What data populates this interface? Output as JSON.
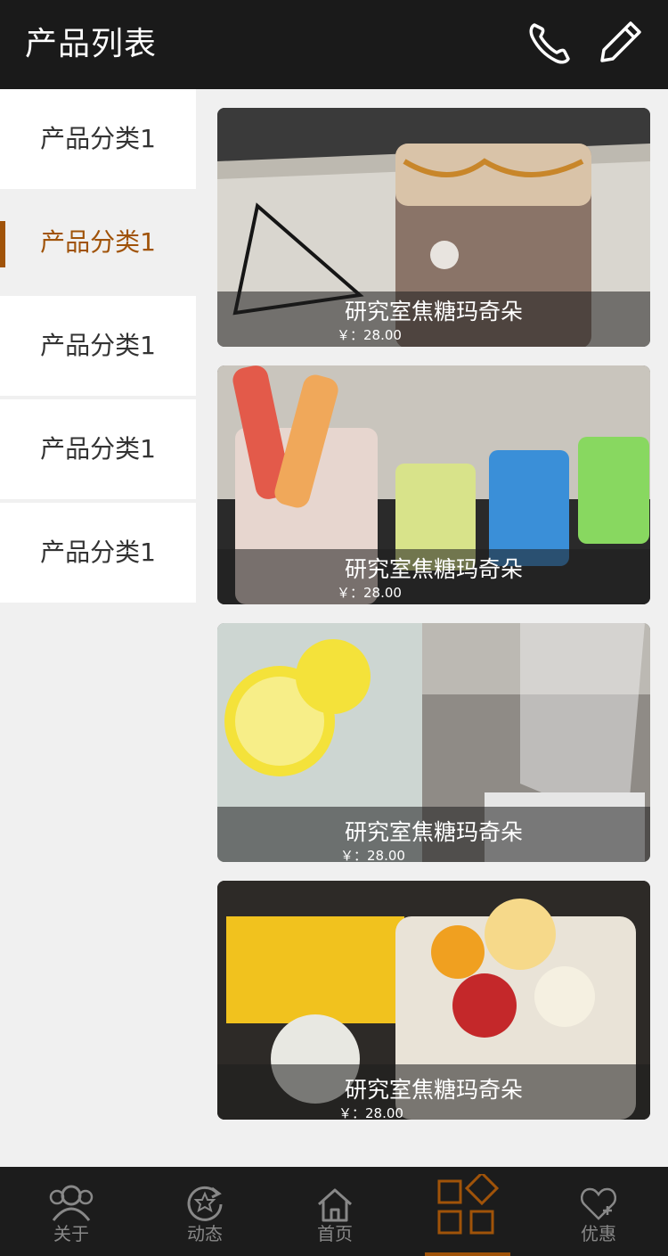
{
  "header": {
    "title": "产品列表",
    "phone_icon": "phone-icon",
    "edit_icon": "pencil-icon"
  },
  "sidebar": {
    "items": [
      {
        "label": "产品分类1",
        "active": false
      },
      {
        "label": "产品分类1",
        "active": true
      },
      {
        "label": "产品分类1",
        "active": false
      },
      {
        "label": "产品分类1",
        "active": false
      },
      {
        "label": "产品分类1",
        "active": false
      }
    ]
  },
  "products": [
    {
      "name": "研究室焦糖玛奇朵",
      "price": "￥：28.00"
    },
    {
      "name": "研究室焦糖玛奇朵",
      "price": "￥：28.00"
    },
    {
      "name": "研究室焦糖玛奇朵",
      "price": "￥：28.00"
    },
    {
      "name": "研究室焦糖玛奇朵",
      "price": "￥：28.00"
    }
  ],
  "tabbar": {
    "tabs": [
      {
        "label": "关于",
        "icon": "people-icon"
      },
      {
        "label": "动态",
        "icon": "refresh-star-icon"
      },
      {
        "label": "首页",
        "icon": "home-icon"
      },
      {
        "label": "",
        "icon": "grid-icon",
        "active": true
      },
      {
        "label": "优惠",
        "icon": "heart-plus-icon"
      }
    ]
  },
  "colors": {
    "accent": "#a05309",
    "topbar": "#1a1a1a",
    "background": "#f0f0f0"
  }
}
